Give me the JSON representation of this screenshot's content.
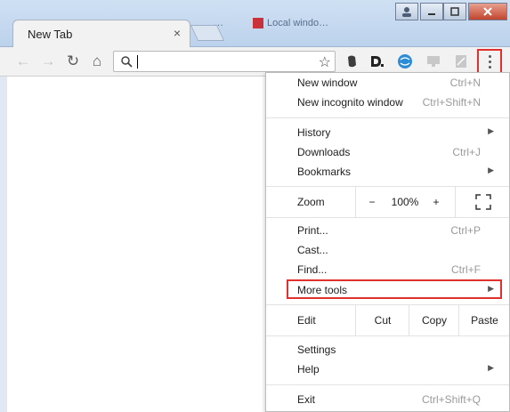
{
  "tab": {
    "title": "New Tab",
    "close": "×"
  },
  "background_tabs": [
    "…",
    "Local windo…"
  ],
  "toolbar": {
    "back": "←",
    "forward": "→",
    "reload": "↻",
    "home": "⌂",
    "bookmark_star": "☆",
    "address_value": ""
  },
  "extensions": [
    "evernote-icon",
    "d-icon",
    "globe-icon",
    "monitor-icon",
    "pdf-icon"
  ],
  "menu": {
    "new_window": {
      "label": "New window",
      "shortcut": "Ctrl+N"
    },
    "new_incognito": {
      "label": "New incognito window",
      "shortcut": "Ctrl+Shift+N"
    },
    "history": {
      "label": "History",
      "arrow": "▶"
    },
    "downloads": {
      "label": "Downloads",
      "shortcut": "Ctrl+J"
    },
    "bookmarks": {
      "label": "Bookmarks",
      "arrow": "▶"
    },
    "zoom": {
      "label": "Zoom",
      "minus": "−",
      "level": "100%",
      "plus": "+"
    },
    "print": {
      "label": "Print...",
      "shortcut": "Ctrl+P"
    },
    "cast": {
      "label": "Cast..."
    },
    "find": {
      "label": "Find...",
      "shortcut": "Ctrl+F"
    },
    "more_tools": {
      "label": "More tools",
      "arrow": "▶"
    },
    "edit": {
      "label": "Edit",
      "cut": "Cut",
      "copy": "Copy",
      "paste": "Paste"
    },
    "settings": {
      "label": "Settings"
    },
    "help": {
      "label": "Help",
      "arrow": "▶"
    },
    "exit": {
      "label": "Exit",
      "shortcut": "Ctrl+Shift+Q"
    }
  },
  "colors": {
    "highlight": "#e0312f",
    "frame": "#bcd2ec"
  }
}
